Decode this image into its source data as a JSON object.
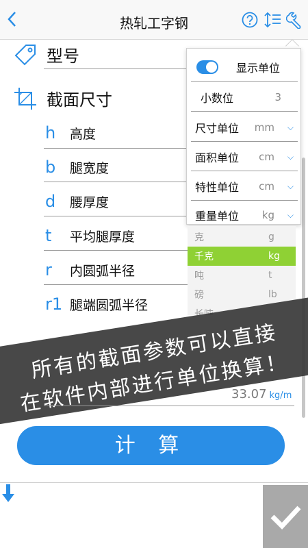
{
  "header": {
    "title": "热轧工字钢",
    "back_icon": "chevron-left-icon",
    "icons": [
      "help-icon",
      "sort-icon",
      "wrench-icon"
    ]
  },
  "sections": {
    "model_label": "型号",
    "model_icon": "tag-icon",
    "section_label": "截面尺寸",
    "section_icon": "crop-icon"
  },
  "dimensions": [
    {
      "symbol": "h",
      "name": "高度"
    },
    {
      "symbol": "b",
      "name": "腿宽度"
    },
    {
      "symbol": "d",
      "name": "腰厚度"
    },
    {
      "symbol": "t",
      "name": "平均腿厚度"
    },
    {
      "symbol": "r",
      "name": "内圆弧半径"
    },
    {
      "symbol": "r1",
      "name": "腿端圆弧半径"
    }
  ],
  "settings_panel": {
    "show_unit_label": "显示单位",
    "show_unit_on": true,
    "decimals_label": "小数位",
    "decimals_value": "3",
    "size_unit_label": "尺寸单位",
    "size_unit_value": "mm",
    "area_unit_label": "面积单位",
    "area_unit_value": "cm",
    "property_unit_label": "特性单位",
    "property_unit_value": "cm",
    "weight_unit_label": "重量单位",
    "weight_unit_value": "kg"
  },
  "weight_dropdown": {
    "options": [
      {
        "label": "克",
        "unit": "g"
      },
      {
        "label": "千克",
        "unit": "kg",
        "selected": true
      },
      {
        "label": "吨",
        "unit": "t"
      },
      {
        "label": "磅",
        "unit": "lb"
      },
      {
        "label": "长吨",
        "unit": ""
      }
    ],
    "selected_color": "#8fd134"
  },
  "banner": {
    "line1": "所有的截面参数可以直接",
    "line2": "在软件内部进行单位换算！"
  },
  "result": {
    "value": "33.07",
    "unit": "kg/m"
  },
  "actions": {
    "calculate_label": "计 算",
    "confirm_icon": "checkmark-icon",
    "down_icon": "arrow-down-icon"
  },
  "colors": {
    "accent": "#2a8ee6",
    "selected": "#8fd134",
    "banner": "#3a3a3a"
  }
}
